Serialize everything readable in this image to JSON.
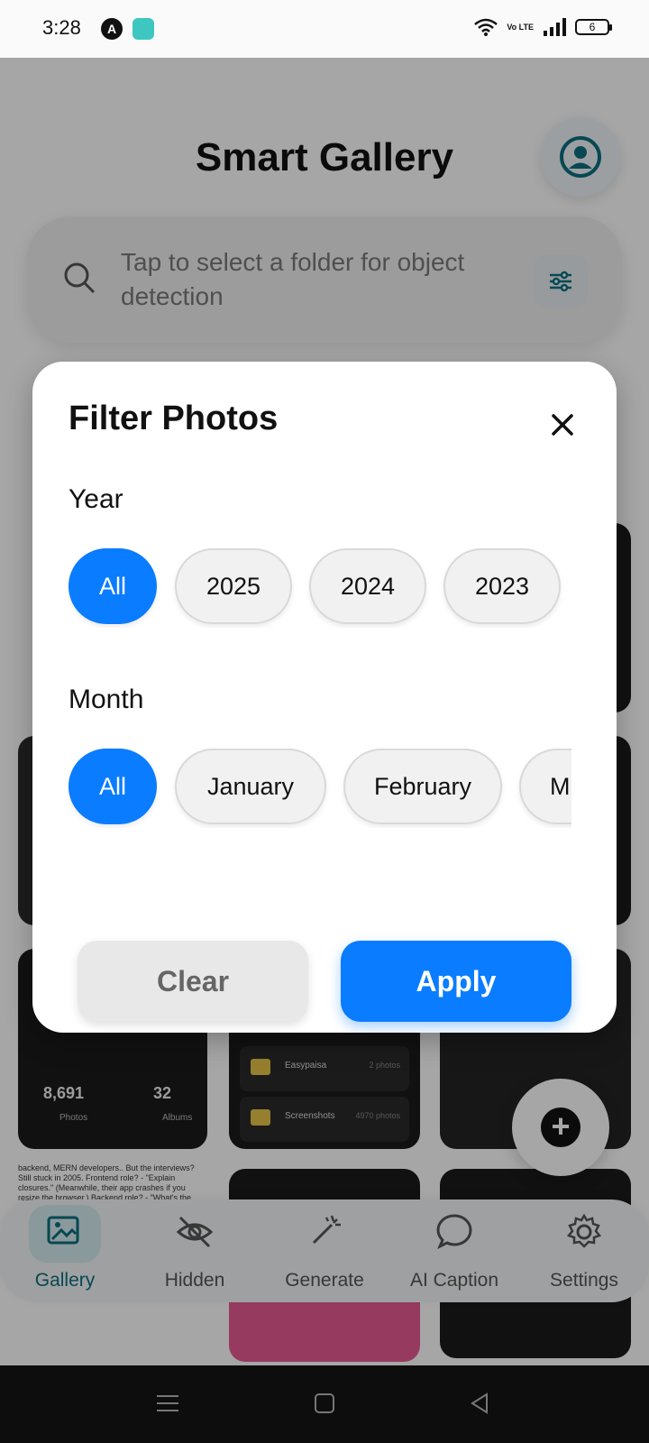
{
  "status_bar": {
    "time": "3:28",
    "volte": "Vo LTE",
    "battery": "6"
  },
  "app": {
    "title": "Smart Gallery",
    "search_placeholder": "Tap to select a folder for object detection",
    "stats": {
      "photos_count": "8,691",
      "photos_label": "Photos",
      "albums_count": "32",
      "albums_label": "Albums"
    },
    "folders": [
      {
        "name": "Easypaisa",
        "count": "2 photos"
      },
      {
        "name": "Screenshots",
        "count": "4970 photos"
      }
    ],
    "text_post": "backend, MERN developers.. But the interviews? Still stuck in 2005. Frontend role? - \"Explain closures.\" (Meanwhile, their app crashes if you resize the browser.) Backend role? - \"What's the difference between... It's 2025. Stop asking textbook questions. Start evaluating actual skills",
    "nav": [
      {
        "label": "Gallery",
        "icon": "image-icon",
        "active": true
      },
      {
        "label": "Hidden",
        "icon": "eye-off-icon",
        "active": false
      },
      {
        "label": "Generate",
        "icon": "magic-wand-icon",
        "active": false
      },
      {
        "label": "AI Caption",
        "icon": "chat-bubble-icon",
        "active": false
      },
      {
        "label": "Settings",
        "icon": "gear-icon",
        "active": false
      }
    ]
  },
  "modal": {
    "title": "Filter Photos",
    "year_label": "Year",
    "years": [
      "All",
      "2025",
      "2024",
      "2023"
    ],
    "year_selected": "All",
    "month_label": "Month",
    "months": [
      "All",
      "January",
      "February",
      "M"
    ],
    "month_selected": "All",
    "clear_label": "Clear",
    "apply_label": "Apply"
  },
  "colors": {
    "accent": "#0a7cff",
    "nav_active": "#0c6f80"
  }
}
